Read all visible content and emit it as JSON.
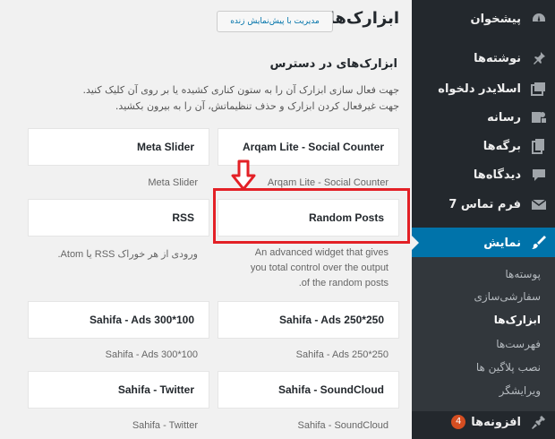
{
  "sidebar": {
    "items": [
      {
        "label": "پیشخوان",
        "icon": "dashboard-icon"
      },
      {
        "label": "نوشته‌ها",
        "icon": "pin-icon"
      },
      {
        "label": "اسلایدر دلخواه",
        "icon": "slider-icon"
      },
      {
        "label": "رسانه",
        "icon": "media-icon"
      },
      {
        "label": "برگه‌ها",
        "icon": "pages-icon"
      },
      {
        "label": "دیدگاه‌ها",
        "icon": "comments-icon"
      },
      {
        "label": "فرم تماس 7",
        "icon": "mail-icon"
      },
      {
        "label": "نمایش",
        "icon": "appearance-icon"
      },
      {
        "label": "افزونه‌ها",
        "icon": "plugins-icon",
        "badge": "4"
      }
    ],
    "submenu": [
      {
        "label": "پوسته‌ها"
      },
      {
        "label": "سفارشی‌سازی"
      },
      {
        "label": "ابزارک‌ها"
      },
      {
        "label": "فهرست‌ها"
      },
      {
        "label": "نصب پلاگین ها"
      },
      {
        "label": "ویرایشگر"
      }
    ]
  },
  "header": {
    "title": "ابزارک‌ها",
    "preview_button": "مدیریت با پیش‌نمایش زنده"
  },
  "available": {
    "title": "ابزارک‌های در دسترس",
    "description_line1": "جهت فعال سازی ابزارک آن را به ستون کناری کشیده یا بر روی آن کلیک کنید.",
    "description_line2": "جهت غیرفعال کردن ابزارک و حذف تنظیماتش، آن را به بیرون بکشید."
  },
  "widgets": {
    "meta_slider": {
      "name": "Meta Slider",
      "desc": "Meta Slider"
    },
    "arqam": {
      "name": "Arqam Lite - Social Counter",
      "desc": "Arqam Lite - Social Counter"
    },
    "rss": {
      "name": "RSS",
      "desc": "ورودی از هر خوراک RSS یا Atom."
    },
    "random_posts": {
      "name": "Random Posts",
      "desc_line1": "An advanced widget that gives",
      "desc_line2": "you total control over the output",
      "desc_line3": ".of the random posts"
    },
    "ads300": {
      "name": "Sahifa - Ads 300*100",
      "desc": "Sahifa - Ads 300*100"
    },
    "ads250": {
      "name": "Sahifa - Ads 250*250",
      "desc": "Sahifa - Ads 250*250"
    },
    "twitter": {
      "name": "Sahifa - Twitter",
      "desc": "Sahifa - Twitter"
    },
    "soundcloud": {
      "name": "Sahifa - SoundCloud",
      "desc": "Sahifa - SoundCloud"
    }
  },
  "colors": {
    "sidebar_bg": "#23282d",
    "active_menu": "#0073aa",
    "highlight": "#e32026"
  }
}
